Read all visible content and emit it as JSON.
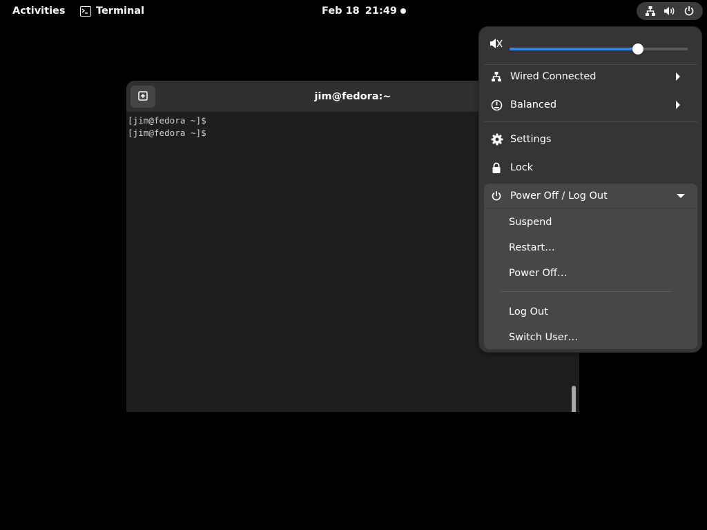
{
  "topbar": {
    "activities": "Activities",
    "app_name": "Terminal",
    "clock_date": "Feb 18",
    "clock_time": "21:49",
    "status_icons": [
      "network-wired-icon",
      "volume-icon",
      "power-icon"
    ]
  },
  "terminal": {
    "title": "jim@fedora:~",
    "lines": [
      "[jim@fedora ~]$",
      "[jim@fedora ~]$"
    ]
  },
  "quick_settings": {
    "volume_fraction": 0.72,
    "items": [
      {
        "label": "Wired Connected",
        "icon": "network-wired-icon",
        "has_submenu": true
      },
      {
        "label": "Balanced",
        "icon": "power-profile-icon",
        "has_submenu": true
      },
      {
        "label": "Settings",
        "icon": "gear-icon",
        "has_submenu": false
      },
      {
        "label": "Lock",
        "icon": "lock-icon",
        "has_submenu": false
      }
    ],
    "power_menu": {
      "label": "Power Off / Log Out",
      "expanded": true,
      "items": [
        "Suspend",
        "Restart…",
        "Power Off…",
        "Log Out",
        "Switch User…"
      ]
    }
  },
  "colors": {
    "accent": "#3584e4",
    "panel_bg": "#353535",
    "submenu_bg": "#474747",
    "terminal_bg": "#1e1e1e"
  }
}
